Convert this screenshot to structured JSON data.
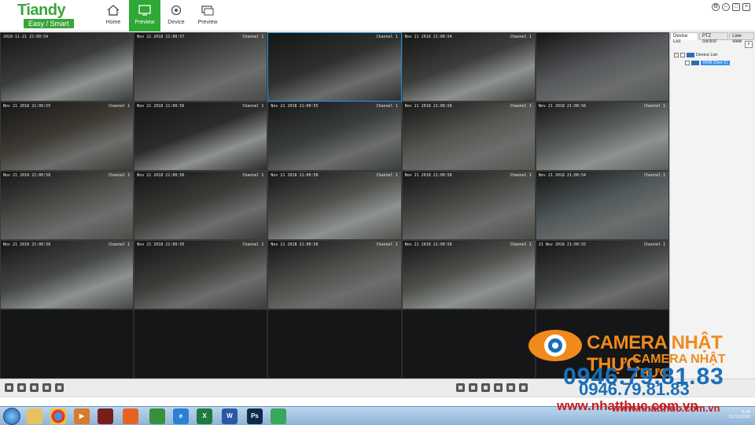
{
  "app": {
    "brand": "Tiandy",
    "tagline": "Easy / Smart"
  },
  "nav": [
    {
      "label": "Home",
      "icon": "home-icon",
      "active": false
    },
    {
      "label": "Preview",
      "icon": "preview-icon",
      "active": true
    },
    {
      "label": "Device",
      "icon": "device-icon",
      "active": false
    },
    {
      "label": "Preview",
      "icon": "preview2-icon",
      "active": false
    }
  ],
  "window_controls": [
    "settings",
    "minimize",
    "maximize",
    "close"
  ],
  "channels": [
    {
      "timestamp": "2018-11-21 22:00:54",
      "channel": ""
    },
    {
      "timestamp": "Nov 21 2018 21:00:57",
      "channel": "Channel 1"
    },
    {
      "timestamp": "",
      "channel": "Channel 1"
    },
    {
      "timestamp": "Nov 21 2018 21:00:54",
      "channel": "Channel 1"
    },
    {
      "timestamp": "",
      "channel": ""
    },
    {
      "timestamp": "Nov 21 2018 21:00:55",
      "channel": "Channel 1"
    },
    {
      "timestamp": "Nov 21 2018 21:00:56",
      "channel": "Channel 1"
    },
    {
      "timestamp": "Nov 21 2018 21:00:55",
      "channel": "Channel 1"
    },
    {
      "timestamp": "Nov 21 2018 21:00:56",
      "channel": "Channel 1"
    },
    {
      "timestamp": "Nov 21 2018 21:00:56",
      "channel": "Channel 1"
    },
    {
      "timestamp": "Nov 21 2018 21:00:56",
      "channel": "Channel 1"
    },
    {
      "timestamp": "Nov 21 2018 21:00:56",
      "channel": "Channel 1"
    },
    {
      "timestamp": "Nov 21 2018 21:00:56",
      "channel": "Channel 1"
    },
    {
      "timestamp": "Nov 21 2018 21:00:56",
      "channel": "Channel 1"
    },
    {
      "timestamp": "Nov 21 2018 21:00:54",
      "channel": "Channel 1"
    },
    {
      "timestamp": "Nov 21 2018 21:00:56",
      "channel": "Channel 1"
    },
    {
      "timestamp": "Nov 21 2018 21:00:55",
      "channel": "Channel 1"
    },
    {
      "timestamp": "Nov 21 2018 21:00:56",
      "channel": "Channel 1"
    },
    {
      "timestamp": "Nov 21 2018 21:00:56",
      "channel": "Channel 1"
    },
    {
      "timestamp": "21 Nov 2018 21:00:55",
      "channel": "Channel 1"
    },
    {
      "timestamp": "",
      "channel": ""
    },
    {
      "timestamp": "",
      "channel": ""
    },
    {
      "timestamp": "",
      "channel": ""
    },
    {
      "timestamp": "",
      "channel": ""
    },
    {
      "timestamp": "",
      "channel": ""
    }
  ],
  "right_panel": {
    "tabs": [
      "Device List",
      "PTZ control",
      "Live-view"
    ],
    "active_tab": "Device List",
    "tree_root": "Device List",
    "tree_child": "NVR (Dev 1)"
  },
  "watermark": {
    "name1": "CAMERA NHẬT THỰC",
    "name2": "CAMERA NHẬT THỰC",
    "phone1": "0946.79.81.83",
    "phone2": "0946.79.81.83",
    "web1": "www.nhatthuc.com.vn",
    "web2": "www.nhatthuc.com.vn"
  },
  "taskbar": {
    "apps": [
      "folder",
      "chrome",
      "media",
      "tiandy",
      "firefox",
      "remote",
      "ie",
      "excel",
      "word",
      "photoshop",
      "app"
    ],
    "time": "5:09",
    "date": "21/11/2018"
  },
  "colors": {
    "accent": "#2ea836",
    "selection": "#1f8ce0",
    "watermark_orange": "#f08a1c",
    "watermark_blue": "#1b6fb8",
    "watermark_red": "#c41f1f"
  }
}
